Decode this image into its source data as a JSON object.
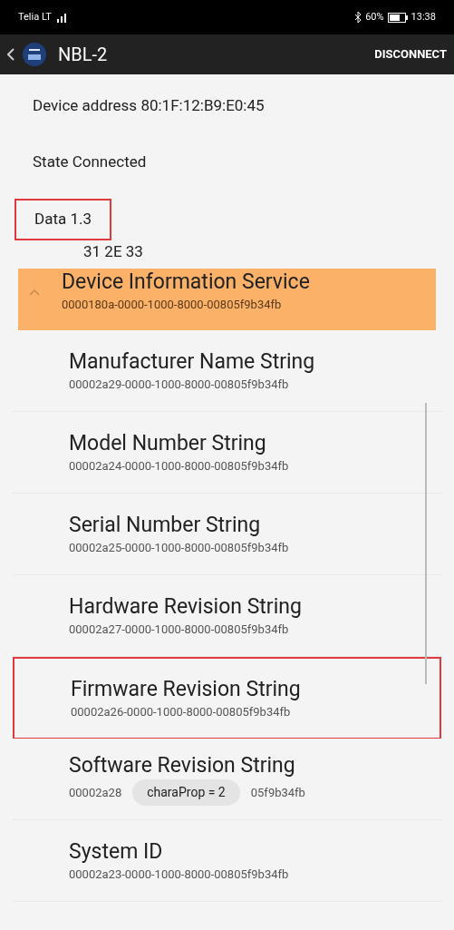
{
  "status_bar": {
    "carrier": "Telia LT",
    "battery": "60%",
    "time": "13:38"
  },
  "app_bar": {
    "title": "NBL-2",
    "action": "DISCONNECT"
  },
  "info": [
    {
      "label": "Device address",
      "value": "80:1F:12:B9:E0:45",
      "highlighted": false
    },
    {
      "label": "State",
      "value": "Connected",
      "highlighted": false
    },
    {
      "label": "Data",
      "value": "1.3",
      "highlighted": true
    }
  ],
  "data_bytes": "31 2E 33",
  "service": {
    "name": "Device Information Service",
    "uuid": "0000180a-0000-1000-8000-00805f9b34fb",
    "expanded": true,
    "selected": true
  },
  "characteristics": [
    {
      "name": "Manufacturer Name String",
      "uuid": "00002a29-0000-1000-8000-00805f9b34fb",
      "highlighted": false
    },
    {
      "name": "Model Number String",
      "uuid": "00002a24-0000-1000-8000-00805f9b34fb",
      "highlighted": false
    },
    {
      "name": "Serial Number String",
      "uuid": "00002a25-0000-1000-8000-00805f9b34fb",
      "highlighted": false
    },
    {
      "name": "Hardware Revision String",
      "uuid": "00002a27-0000-1000-8000-00805f9b34fb",
      "highlighted": false
    },
    {
      "name": "Firmware Revision String",
      "uuid": "00002a26-0000-1000-8000-00805f9b34fb",
      "highlighted": true
    },
    {
      "name": "Software Revision String",
      "uuid_start": "00002a28",
      "uuid_end": "05f9b34fb",
      "toast": "charaProp = 2",
      "highlighted": false
    },
    {
      "name": "System ID",
      "uuid": "00002a23-0000-1000-8000-00805f9b34fb",
      "highlighted": false
    }
  ]
}
